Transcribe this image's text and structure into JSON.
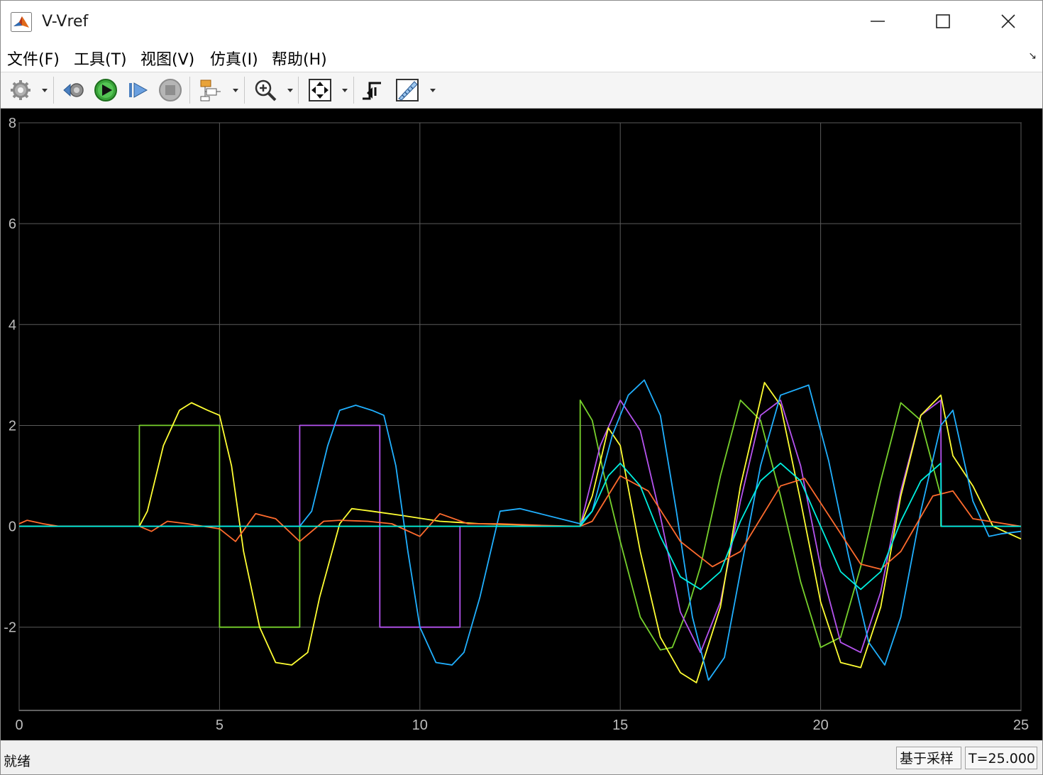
{
  "window": {
    "title": "V-Vref"
  },
  "menu": [
    {
      "label": "文件(F)"
    },
    {
      "label": "工具(T)"
    },
    {
      "label": "视图(V)"
    },
    {
      "label": "仿真(I)"
    },
    {
      "label": "帮助(H)"
    }
  ],
  "toolbar": {
    "buttons": [
      {
        "icon": "gear-icon",
        "has_dropdown": true
      },
      {
        "icon": "step-back-icon",
        "has_dropdown": false
      },
      {
        "icon": "run-icon",
        "has_dropdown": false
      },
      {
        "icon": "step-forward-icon",
        "has_dropdown": false
      },
      {
        "icon": "stop-icon",
        "has_dropdown": false
      },
      {
        "icon": "highlight-block-icon",
        "has_dropdown": true
      },
      {
        "icon": "zoom-in-icon",
        "has_dropdown": true
      },
      {
        "icon": "autoscale-icon",
        "has_dropdown": true
      },
      {
        "icon": "triggers-icon",
        "has_dropdown": false
      },
      {
        "icon": "measurements-icon",
        "has_dropdown": true
      }
    ]
  },
  "status": {
    "text": "就绪",
    "mode": "基于采样",
    "time": "T=25.000"
  },
  "chart_data": {
    "type": "line",
    "xlim": [
      0,
      25
    ],
    "ylim": [
      -3.65,
      8
    ],
    "xticks": [
      0,
      5,
      10,
      15,
      20,
      25
    ],
    "yticks": [
      -2,
      0,
      2,
      4,
      6,
      8
    ],
    "xtick_labels": [
      "0",
      "5",
      "10",
      "15",
      "20",
      "25"
    ],
    "ytick_labels": [
      "-2",
      "0",
      "2",
      "4",
      "6",
      "8"
    ],
    "grid": true,
    "background": "#000000",
    "series": [
      {
        "color": "#77d12c",
        "x": [
          0,
          3,
          3,
          5,
          5,
          7,
          7,
          14,
          14,
          14.3,
          14.6,
          15,
          15.5,
          16,
          16.3,
          16.7,
          17,
          17.5,
          18,
          18.5,
          19,
          19.5,
          20,
          20.5,
          21,
          21.5,
          22,
          22.5,
          23,
          23,
          25
        ],
        "y": [
          0,
          0,
          2,
          2,
          -2,
          -2,
          0,
          0,
          2.5,
          2.1,
          1.0,
          -0.3,
          -1.8,
          -2.45,
          -2.4,
          -1.6,
          -0.8,
          1.0,
          2.5,
          2.1,
          0.6,
          -1.1,
          -2.4,
          -2.2,
          -0.8,
          0.9,
          2.45,
          2.1,
          0.6,
          0,
          0
        ]
      },
      {
        "color": "#b553ef",
        "x": [
          0,
          7,
          7,
          9,
          9,
          11,
          11,
          14,
          14.5,
          15,
          15.5,
          16,
          16.5,
          17,
          17.5,
          18,
          18.5,
          19,
          19.5,
          20,
          20.5,
          21,
          21.5,
          22,
          22.5,
          23,
          23.01,
          25
        ],
        "y": [
          0,
          0,
          2,
          2,
          -2,
          -2,
          0,
          0,
          1.6,
          2.5,
          1.9,
          0.2,
          -1.7,
          -2.5,
          -1.5,
          0.5,
          2.2,
          2.5,
          1.2,
          -0.8,
          -2.3,
          -2.5,
          -1.3,
          0.7,
          2.2,
          2.5,
          0,
          0
        ]
      },
      {
        "color": "#ffff33",
        "x": [
          0,
          3,
          3.2,
          3.6,
          4.0,
          4.3,
          4.7,
          5.0,
          5.3,
          5.6,
          6.0,
          6.4,
          6.8,
          7.2,
          7.5,
          8.0,
          8.3,
          8.8,
          9.5,
          10.5,
          11.5,
          12.5,
          13.5,
          14,
          14.3,
          14.7,
          15,
          15.5,
          16,
          16.5,
          16.9,
          17.5,
          18,
          18.6,
          19,
          19.5,
          20,
          20.5,
          21,
          21.5,
          22,
          22.5,
          23,
          23.3,
          23.8,
          24.3,
          25
        ],
        "y": [
          0,
          0,
          0.3,
          1.6,
          2.3,
          2.45,
          2.3,
          2.2,
          1.2,
          -0.5,
          -2.0,
          -2.7,
          -2.75,
          -2.5,
          -1.4,
          0.05,
          0.35,
          0.3,
          0.22,
          0.1,
          0.05,
          0.03,
          0,
          0,
          0.6,
          1.95,
          1.6,
          -0.5,
          -2.2,
          -2.9,
          -3.1,
          -1.6,
          0.8,
          2.85,
          2.4,
          0.5,
          -1.5,
          -2.7,
          -2.8,
          -1.6,
          0.6,
          2.2,
          2.6,
          1.4,
          0.8,
          0,
          -0.25
        ]
      },
      {
        "color": "#20b0ff",
        "x": [
          0,
          7,
          7.3,
          7.7,
          8.0,
          8.4,
          8.8,
          9.1,
          9.4,
          9.7,
          10.0,
          10.4,
          10.8,
          11.1,
          11.5,
          12.0,
          12.5,
          13.0,
          14.0,
          14.3,
          14.8,
          15.2,
          15.6,
          16,
          16.4,
          16.8,
          17.2,
          17.6,
          18,
          18.5,
          19,
          19.7,
          20.2,
          20.7,
          21.2,
          21.6,
          22,
          22.5,
          23,
          23.3,
          23.8,
          24.2,
          24.5,
          25
        ],
        "y": [
          0,
          0,
          0.3,
          1.6,
          2.3,
          2.4,
          2.3,
          2.2,
          1.2,
          -0.5,
          -2.0,
          -2.7,
          -2.75,
          -2.5,
          -1.4,
          0.3,
          0.35,
          0.25,
          0.05,
          0.3,
          1.8,
          2.6,
          2.9,
          2.2,
          0.3,
          -1.8,
          -3.05,
          -2.6,
          -0.9,
          1.2,
          2.6,
          2.8,
          1.3,
          -0.6,
          -2.3,
          -2.75,
          -1.8,
          0.3,
          2.0,
          2.3,
          0.5,
          -0.2,
          -0.15,
          -0.1
        ]
      },
      {
        "color": "#ff6b2d",
        "x": [
          0,
          0.2,
          0.6,
          1.0,
          3.0,
          3.3,
          3.7,
          4.2,
          5.0,
          5.4,
          5.9,
          6.4,
          7.0,
          7.6,
          8.0,
          8.7,
          9.3,
          10.0,
          10.5,
          11.2,
          12.0,
          13.0,
          14.0,
          14.3,
          15,
          15.7,
          16.5,
          17.3,
          18,
          19,
          19.6,
          20.3,
          21,
          21.5,
          22,
          22.8,
          23.3,
          23.8,
          25
        ],
        "y": [
          0.05,
          0.12,
          0.05,
          0,
          0,
          -0.1,
          0.1,
          0.05,
          -0.05,
          -0.3,
          0.25,
          0.15,
          -0.3,
          0.1,
          0.12,
          0.1,
          0.05,
          -0.2,
          0.25,
          0.05,
          0.05,
          0.02,
          0,
          0.1,
          1.0,
          0.7,
          -0.3,
          -0.8,
          -0.5,
          0.8,
          0.95,
          0.1,
          -0.75,
          -0.85,
          -0.5,
          0.6,
          0.7,
          0.15,
          0
        ]
      },
      {
        "color": "#00f0e0",
        "x": [
          0,
          14.0,
          14.3,
          14.7,
          15,
          15.5,
          16,
          16.5,
          17,
          17.5,
          18,
          18.5,
          19,
          19.5,
          20,
          20.5,
          21,
          21.5,
          22,
          22.5,
          23,
          23.01,
          25
        ],
        "y": [
          0,
          0,
          0.3,
          1.0,
          1.25,
          0.8,
          -0.2,
          -1.0,
          -1.25,
          -0.9,
          0.1,
          0.9,
          1.25,
          0.9,
          0,
          -0.9,
          -1.25,
          -0.9,
          0.1,
          0.9,
          1.25,
          0,
          0
        ]
      }
    ]
  }
}
